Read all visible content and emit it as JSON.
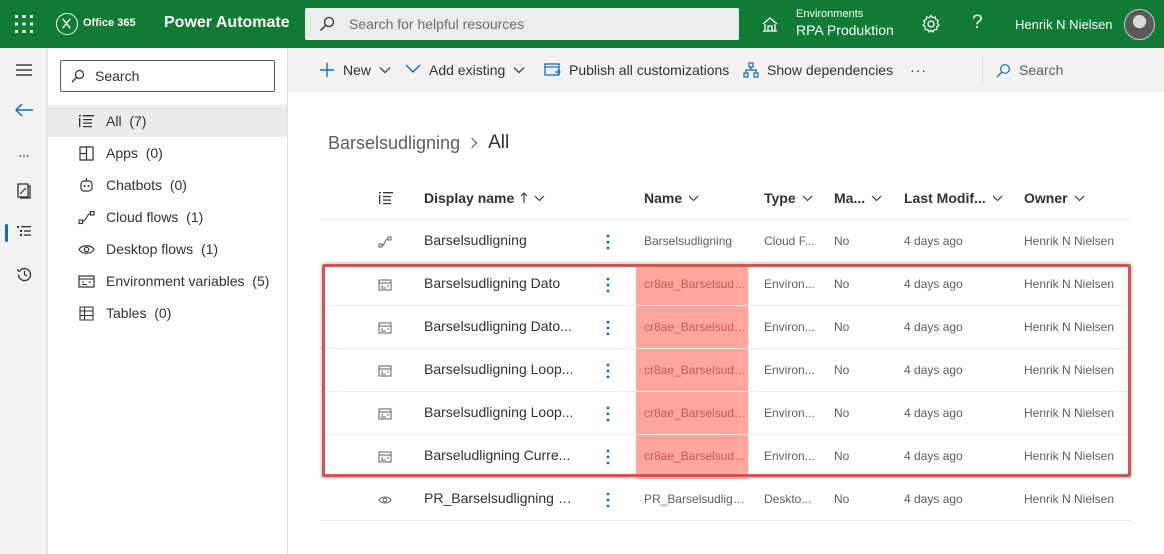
{
  "topbar": {
    "suite_name": "Office 365",
    "app_title": "Power Automate",
    "search_placeholder": "Search for helpful resources",
    "environment_label": "Environments",
    "environment_value": "RPA Produktion",
    "help_glyph": "?",
    "user_name": "Henrik N Nielsen",
    "bg_color": "#0f7b33"
  },
  "rail": {
    "items": [
      "hamburger-icon",
      "back-arrow-icon",
      "more-icon",
      "book-icon",
      "tree-list-icon",
      "history-icon"
    ],
    "more_glyph": "..."
  },
  "sidenav": {
    "search_placeholder": "Search",
    "items": [
      {
        "label": "All",
        "count": "(7)",
        "icon": "list-icon",
        "selected": true
      },
      {
        "label": "Apps",
        "count": "(0)",
        "icon": "apps-icon"
      },
      {
        "label": "Chatbots",
        "count": "(0)",
        "icon": "chatbot-icon"
      },
      {
        "label": "Cloud flows",
        "count": "(1)",
        "icon": "cloud-flow-icon"
      },
      {
        "label": "Desktop flows",
        "count": "(1)",
        "icon": "desktop-flow-icon"
      },
      {
        "label": "Environment variables",
        "count": "(5)",
        "icon": "env-variable-icon"
      },
      {
        "label": "Tables",
        "count": "(0)",
        "icon": "table-icon"
      }
    ]
  },
  "commandbar": {
    "new_label": "New",
    "add_existing_label": "Add existing",
    "publish_label": "Publish all customizations",
    "dependencies_label": "Show dependencies",
    "overflow_glyph": "···",
    "search_label": "Search"
  },
  "breadcrumb": {
    "parent": "Barselsudligning",
    "current": "All"
  },
  "grid": {
    "columns": {
      "display_name": "Display name",
      "name": "Name",
      "type": "Type",
      "managed": "Ma...",
      "last_modified": "Last Modif...",
      "owner": "Owner"
    },
    "rows": [
      {
        "icon": "cloud-flow-icon",
        "display_name": "Barselsudligning",
        "name": "Barselsudligning",
        "type": "Cloud F...",
        "managed": "No",
        "modified": "4 days ago",
        "owner": "Henrik N Nielsen"
      },
      {
        "icon": "env-variable-icon",
        "display_name": "Barselsudligning Dato",
        "name": "cr8ae_Barselsudli...",
        "type": "Environ...",
        "managed": "No",
        "modified": "4 days ago",
        "owner": "Henrik N Nielsen"
      },
      {
        "icon": "env-variable-icon",
        "display_name": "Barselsudligning Dato...",
        "name": "cr8ae_Barselsudli...",
        "type": "Environ...",
        "managed": "No",
        "modified": "4 days ago",
        "owner": "Henrik N Nielsen"
      },
      {
        "icon": "env-variable-icon",
        "display_name": "Barselsudligning Loop...",
        "name": "cr8ae_Barselsudli...",
        "type": "Environ...",
        "managed": "No",
        "modified": "4 days ago",
        "owner": "Henrik N Nielsen"
      },
      {
        "icon": "env-variable-icon",
        "display_name": "Barselsudligning Loop...",
        "name": "cr8ae_Barselsudli...",
        "type": "Environ...",
        "managed": "No",
        "modified": "4 days ago",
        "owner": "Henrik N Nielsen"
      },
      {
        "icon": "env-variable-icon",
        "display_name": "Barseludligning Curre...",
        "name": "cr8ae_Barselsudli...",
        "type": "Environ...",
        "managed": "No",
        "modified": "4 days ago",
        "owner": "Henrik N Nielsen"
      },
      {
        "icon": "desktop-flow-icon",
        "display_name": "PR_Barselsudligning E...",
        "name": "PR_Barselsudlign...",
        "type": "Deskto...",
        "managed": "No",
        "modified": "4 days ago",
        "owner": "Henrik N Nielsen"
      }
    ],
    "highlight_color": "#d9534f",
    "name_highlight_color": "#ffa69e"
  }
}
